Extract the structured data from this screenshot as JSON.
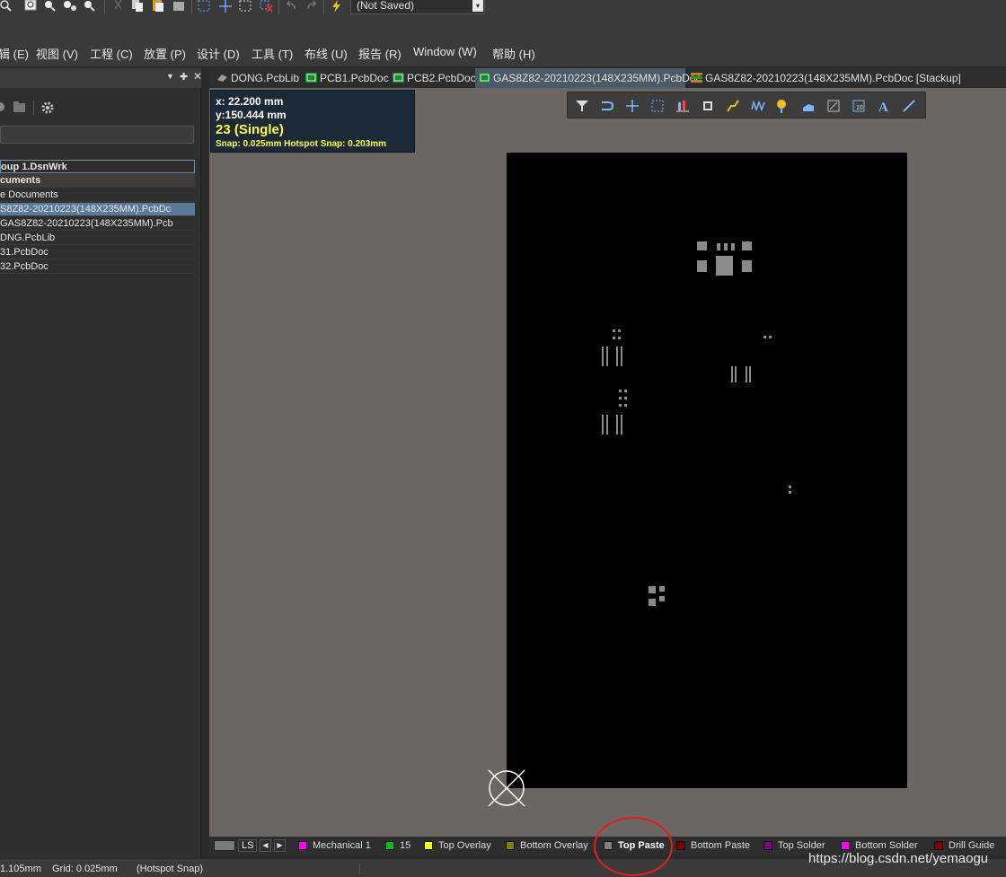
{
  "toolbar": {
    "save_state": "(Not Saved)"
  },
  "menu": [
    {
      "label": "辑 (E)"
    },
    {
      "label": "视图 (V)"
    },
    {
      "label": "工程 (C)"
    },
    {
      "label": "放置 (P)"
    },
    {
      "label": "设计 (D)"
    },
    {
      "label": "工具 (T)"
    },
    {
      "label": "布线 (U)"
    },
    {
      "label": "报告 (R)"
    },
    {
      "label": "Window (W)"
    },
    {
      "label": "帮助 (H)"
    }
  ],
  "project_panel": {
    "items": [
      {
        "label": "oup 1.DsnWrk"
      },
      {
        "label": "cuments"
      },
      {
        "label": "e Documents"
      },
      {
        "label": "S8Z82-20210223(148X235MM).PcbDc"
      },
      {
        "label": "GAS8Z82-20210223(148X235MM).Pcb"
      },
      {
        "label": "DNG.PcbLib"
      },
      {
        "label": "31.PcbDoc"
      },
      {
        "label": "32.PcbDoc"
      }
    ]
  },
  "tabs": [
    {
      "label": "DONG.PcbLib"
    },
    {
      "label": "PCB1.PcbDoc"
    },
    {
      "label": "PCB2.PcbDoc"
    },
    {
      "label": "GAS8Z82-20210223(148X235MM).PcbDoc"
    },
    {
      "label": "GAS8Z82-20210223(148X235MM).PcbDoc [Stackup]"
    }
  ],
  "coords": {
    "x": "x: 22.200  mm",
    "y": "y:150.444  mm",
    "layer": "23 (Single)",
    "snap": "Snap: 0.025mm Hotspot Snap: 0.203mm"
  },
  "layers": {
    "ls_label": "LS",
    "items": [
      {
        "label": "Mechanical 1",
        "color": "#ff00ff"
      },
      {
        "label": "15",
        "color": "#00c000"
      },
      {
        "label": "Top Overlay",
        "color": "#ffff00"
      },
      {
        "label": "Bottom Overlay",
        "color": "#808000"
      },
      {
        "label": "Top Paste",
        "color": "#808080"
      },
      {
        "label": "Bottom Paste",
        "color": "#800000"
      },
      {
        "label": "Top Solder",
        "color": "#800080"
      },
      {
        "label": "Bottom Solder",
        "color": "#ff00ff"
      },
      {
        "label": "Drill Guide",
        "color": "#800000"
      }
    ]
  },
  "status": {
    "position": "1.105mm",
    "grid": "Grid: 0.025mm",
    "snap": "(Hotspot Snap)"
  },
  "watermark": "https://blog.csdn.net/yemaogu"
}
